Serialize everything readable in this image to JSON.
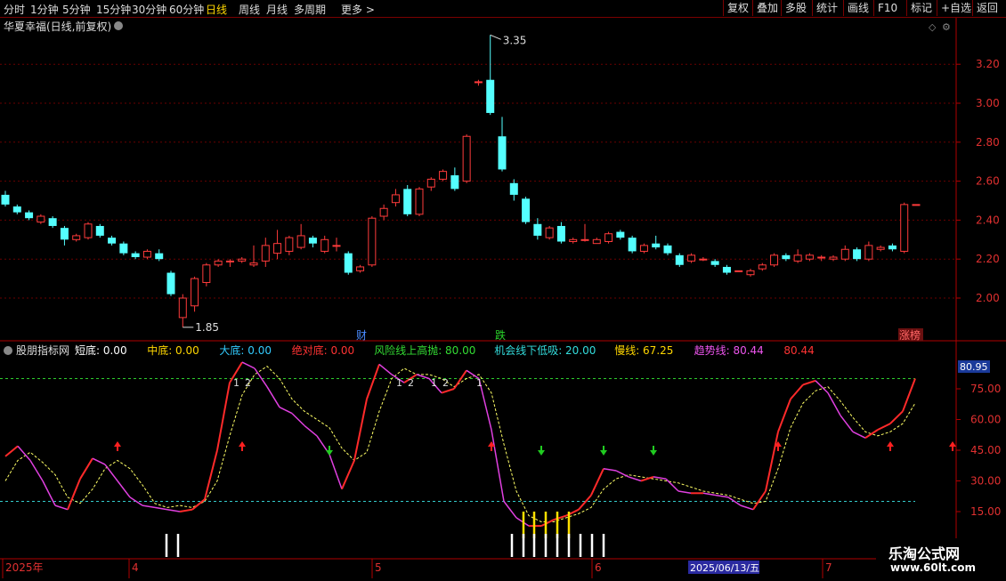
{
  "toolbar": {
    "periods": [
      "分时",
      "1分钟",
      "5分钟",
      "15分钟",
      "30分钟",
      "60分钟",
      "日线",
      "周线",
      "月线",
      "多周期",
      "更多 >"
    ],
    "active_period": "日线",
    "right_buttons": [
      "复权",
      "叠加",
      "多股",
      "统计",
      "画线",
      "F10",
      "标记",
      "+自选",
      "返回"
    ]
  },
  "main_panel": {
    "title": "华夏幸福(日线,前复权)",
    "price_axis": [
      "3.20",
      "3.00",
      "2.80",
      "2.60",
      "2.40",
      "2.20",
      "2.00"
    ],
    "high_label": "3.35",
    "low_label": "1.85",
    "event_tags": [
      {
        "text": "财",
        "color": "#4a8cff"
      },
      {
        "text": "跌",
        "color": "#2ad42a"
      },
      {
        "text": "涨榜",
        "color": "#ff6666"
      }
    ]
  },
  "indicator_panel": {
    "name": "股朋指标网",
    "values": [
      {
        "label": "短底:",
        "value": "0.00",
        "color": "#ffffff"
      },
      {
        "label": "中底:",
        "value": "0.00",
        "color": "#ffd700"
      },
      {
        "label": "大底:",
        "value": "0.00",
        "color": "#33ccff"
      },
      {
        "label": "绝对底:",
        "value": "0.00",
        "color": "#ff3333"
      },
      {
        "label": "风险线上高抛:",
        "value": "80.00",
        "color": "#33dd33"
      },
      {
        "label": "机会线下低吸:",
        "value": "20.00",
        "color": "#33dddd"
      },
      {
        "label": "慢线:",
        "value": "67.25",
        "color": "#ffd700"
      },
      {
        "label": "趋势线:",
        "value": "80.44",
        "color": "#ee55ee"
      },
      {
        "label": "",
        "value": "80.44",
        "color": "#ff3333"
      }
    ],
    "axis": [
      "75.00",
      "60.00",
      "45.00",
      "30.00",
      "15.00"
    ],
    "current_value": "80.95",
    "number_labels": [
      "1",
      "2",
      "1",
      "2",
      "1",
      "2",
      "1"
    ]
  },
  "time_axis": {
    "labels": [
      "2025年",
      "4",
      "5",
      "6",
      "7"
    ],
    "cursor_date": "2025/06/13/五"
  },
  "watermark": {
    "line1": "乐淘公式网",
    "line2": "www.60lt.com"
  },
  "chart_data": [
    {
      "type": "candlestick",
      "title": "华夏幸福(日线,前复权)",
      "ylim": [
        1.85,
        3.35
      ],
      "candles": [
        [
          2.53,
          2.48,
          2.55,
          2.47
        ],
        [
          2.47,
          2.44,
          2.48,
          2.43
        ],
        [
          2.44,
          2.41,
          2.45,
          2.4
        ],
        [
          2.39,
          2.42,
          2.43,
          2.38
        ],
        [
          2.41,
          2.37,
          2.42,
          2.36
        ],
        [
          2.36,
          2.3,
          2.37,
          2.27
        ],
        [
          2.3,
          2.32,
          2.33,
          2.29
        ],
        [
          2.31,
          2.38,
          2.39,
          2.3
        ],
        [
          2.37,
          2.32,
          2.38,
          2.31
        ],
        [
          2.31,
          2.28,
          2.32,
          2.27
        ],
        [
          2.28,
          2.23,
          2.29,
          2.22
        ],
        [
          2.23,
          2.21,
          2.24,
          2.2
        ],
        [
          2.21,
          2.24,
          2.25,
          2.2
        ],
        [
          2.23,
          2.2,
          2.25,
          2.19
        ],
        [
          2.13,
          2.02,
          2.14,
          2.01
        ],
        [
          1.9,
          2.0,
          2.02,
          1.85
        ],
        [
          1.96,
          2.1,
          2.11,
          1.93
        ],
        [
          2.08,
          2.17,
          2.18,
          2.06
        ],
        [
          2.17,
          2.19,
          2.2,
          2.16
        ],
        [
          2.19,
          2.19,
          2.2,
          2.16
        ],
        [
          2.19,
          2.2,
          2.21,
          2.18
        ],
        [
          2.17,
          2.18,
          2.27,
          2.16
        ],
        [
          2.19,
          2.27,
          2.31,
          2.16
        ],
        [
          2.23,
          2.28,
          2.35,
          2.2
        ],
        [
          2.24,
          2.31,
          2.32,
          2.22
        ],
        [
          2.26,
          2.32,
          2.38,
          2.25
        ],
        [
          2.31,
          2.28,
          2.32,
          2.26
        ],
        [
          2.24,
          2.3,
          2.32,
          2.23
        ],
        [
          2.27,
          2.27,
          2.31,
          2.24
        ],
        [
          2.23,
          2.13,
          2.24,
          2.12
        ],
        [
          2.14,
          2.16,
          2.17,
          2.13
        ],
        [
          2.17,
          2.41,
          2.42,
          2.16
        ],
        [
          2.42,
          2.46,
          2.48,
          2.4
        ],
        [
          2.49,
          2.53,
          2.56,
          2.47
        ],
        [
          2.56,
          2.43,
          2.58,
          2.42
        ],
        [
          2.43,
          2.56,
          2.57,
          2.42
        ],
        [
          2.57,
          2.61,
          2.62,
          2.55
        ],
        [
          2.61,
          2.65,
          2.66,
          2.6
        ],
        [
          2.63,
          2.56,
          2.67,
          2.55
        ],
        [
          2.6,
          2.83,
          2.84,
          2.59
        ],
        [
          3.11,
          3.11,
          3.12,
          3.09
        ],
        [
          3.12,
          2.95,
          3.35,
          2.94
        ],
        [
          2.83,
          2.66,
          2.93,
          2.65
        ],
        [
          2.59,
          2.53,
          2.61,
          2.5
        ],
        [
          2.51,
          2.39,
          2.52,
          2.38
        ],
        [
          2.38,
          2.32,
          2.41,
          2.3
        ],
        [
          2.31,
          2.36,
          2.37,
          2.3
        ],
        [
          2.37,
          2.29,
          2.39,
          2.28
        ],
        [
          2.29,
          2.3,
          2.31,
          2.28
        ],
        [
          2.3,
          2.3,
          2.38,
          2.29
        ],
        [
          2.28,
          2.3,
          2.31,
          2.28
        ],
        [
          2.29,
          2.33,
          2.34,
          2.28
        ],
        [
          2.34,
          2.31,
          2.35,
          2.3
        ],
        [
          2.31,
          2.24,
          2.32,
          2.23
        ],
        [
          2.24,
          2.27,
          2.28,
          2.23
        ],
        [
          2.28,
          2.26,
          2.32,
          2.25
        ],
        [
          2.27,
          2.23,
          2.28,
          2.22
        ],
        [
          2.22,
          2.17,
          2.23,
          2.16
        ],
        [
          2.19,
          2.22,
          2.23,
          2.18
        ],
        [
          2.2,
          2.2,
          2.21,
          2.19
        ],
        [
          2.19,
          2.17,
          2.2,
          2.16
        ],
        [
          2.16,
          2.13,
          2.17,
          2.12
        ],
        [
          2.14,
          2.14,
          2.14,
          2.14
        ],
        [
          2.12,
          2.14,
          2.15,
          2.11
        ],
        [
          2.15,
          2.17,
          2.18,
          2.14
        ],
        [
          2.17,
          2.22,
          2.23,
          2.16
        ],
        [
          2.22,
          2.2,
          2.23,
          2.19
        ],
        [
          2.19,
          2.22,
          2.25,
          2.18
        ],
        [
          2.2,
          2.22,
          2.23,
          2.19
        ],
        [
          2.21,
          2.21,
          2.22,
          2.19
        ],
        [
          2.2,
          2.21,
          2.22,
          2.19
        ],
        [
          2.2,
          2.25,
          2.27,
          2.19
        ],
        [
          2.25,
          2.2,
          2.26,
          2.19
        ],
        [
          2.2,
          2.27,
          2.29,
          2.19
        ],
        [
          2.25,
          2.26,
          2.27,
          2.24
        ],
        [
          2.27,
          2.25,
          2.28,
          2.24
        ],
        [
          2.24,
          2.48,
          2.49,
          2.23
        ],
        [
          2.48,
          2.48,
          2.48,
          2.48
        ]
      ]
    },
    {
      "type": "line",
      "title": "股朋指标网",
      "ylim": [
        8,
        90
      ],
      "hlines": [
        80,
        20
      ],
      "series": [
        {
          "name": "趋势线",
          "values": [
            42,
            47,
            40,
            30,
            18,
            16,
            31,
            41,
            38,
            30,
            22,
            18,
            17,
            16,
            15,
            16,
            21,
            45,
            78,
            88,
            85,
            76,
            66,
            63,
            57,
            52,
            43,
            26,
            40,
            70,
            87,
            82,
            78,
            82,
            80,
            73,
            75,
            84,
            80,
            55,
            20,
            12,
            8,
            8,
            11,
            13,
            16,
            23,
            36,
            35,
            32,
            30,
            32,
            31,
            25,
            24,
            24,
            23,
            22,
            18,
            16,
            25,
            54,
            70,
            77,
            79,
            73,
            62,
            54,
            51,
            55,
            58,
            64,
            80
          ]
        },
        {
          "name": "慢线",
          "values": [
            30,
            40,
            44,
            39,
            33,
            22,
            19,
            26,
            36,
            40,
            36,
            28,
            19,
            17,
            18,
            17,
            20,
            30,
            52,
            72,
            82,
            86,
            80,
            70,
            64,
            60,
            56,
            46,
            40,
            44,
            64,
            80,
            85,
            82,
            82,
            80,
            76,
            80,
            82,
            73,
            48,
            25,
            13,
            10,
            10,
            12,
            14,
            17,
            26,
            31,
            33,
            32,
            31,
            30,
            29,
            27,
            25,
            24,
            23,
            21,
            19,
            20,
            36,
            56,
            68,
            74,
            76,
            69,
            61,
            54,
            52,
            54,
            58,
            68
          ]
        }
      ]
    }
  ]
}
